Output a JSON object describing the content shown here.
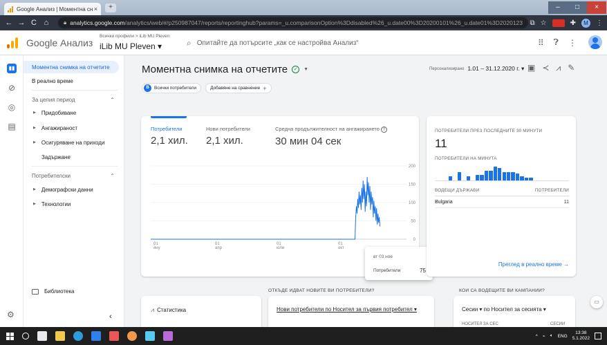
{
  "browser": {
    "tab_title": "Google Анализ | Моментна сн",
    "tab_close": "×",
    "new_tab": "+",
    "url_host": "analytics.google.com",
    "url_path": "/analytics/web/#/p250987047/reports/reportinghub?params=_u.comparisonOption%3Ddisabled%26_u.date00%3D20200101%26_u.date01%3D20201231",
    "back": "←",
    "forward": "→",
    "reload": "C",
    "home": "⌂",
    "extension_m": "M"
  },
  "header": {
    "product_name": "Google Анализ",
    "breadcrumb": "Всички профили > iLib MU Pleven",
    "property_name": "iLib MU Pleven ▾",
    "search_placeholder": "Опитайте да потърсите „как се настройва Анализ“"
  },
  "sidebar": {
    "items": [
      {
        "label": "Моментна снимка на отчетите"
      },
      {
        "label": "В реално време"
      },
      {
        "label": "За целия период"
      },
      {
        "label": "Придобиване"
      },
      {
        "label": "Ангажираност"
      },
      {
        "label": "Осигуряване на приходи"
      },
      {
        "label": "Задържане"
      },
      {
        "label": "Потребителски"
      },
      {
        "label": "Демографски данни"
      },
      {
        "label": "Технологии"
      }
    ],
    "library": "Библиотека",
    "collapse": "‹"
  },
  "main": {
    "title": "Моментна снимка на отчетите",
    "date_label": "Персонализирано",
    "date_range": "1.01 – 31.12.2020 г. ▾",
    "chip_all_users": "Всички потребители",
    "chip_all_users_badge": "B",
    "chip_compare": "Добавяне на сравнение",
    "metrics": [
      {
        "label": "Потребители",
        "value": "2,1 хил."
      },
      {
        "label": "Нови потребители",
        "value": "2,1 хил."
      },
      {
        "label": "Средна продължителност на ангажирането",
        "value": "30 мин 04 сек"
      }
    ],
    "tooltip": {
      "date": "вт 03 ное",
      "key": "Потребители",
      "value": "75"
    }
  },
  "realtime": {
    "title": "ПОТРЕБИТЕЛИ ПРЕЗ ПОСЛЕДНИТЕ 30 МИНУТИ",
    "count": "11",
    "per_minute": "ПОТРЕБИТЕЛИ НА МИНУТА",
    "col_country": "ВОДЕЩИ ДЪРЖАВИ",
    "col_users": "ПОТРЕБИТЕЛИ",
    "row_country": "Bulgaria",
    "row_users": "11",
    "link": "Преглед в реално време →",
    "bars": [
      0,
      0,
      0,
      0.3,
      0,
      0.6,
      0,
      0.3,
      0,
      0.4,
      0.4,
      0.7,
      0.7,
      1.0,
      0.9,
      0.6,
      0.6,
      0.6,
      0.5,
      0.3,
      0.2,
      0.2,
      0,
      0,
      0,
      0,
      0,
      0,
      0,
      0
    ]
  },
  "bottom": {
    "section_new_users": "ОТКЪДЕ ИДВАТ НОВИТЕ ВИ ПОТРЕБИТЕЛИ?",
    "section_campaigns": "КОИ СА ВОДЕЩИТЕ ВИ КАМПАНИИ?",
    "insights": "Статистика",
    "new_users_dim": "Нови потребители по Носител за първия потребител ▾",
    "sessions_dim": "Сесии ▾ по Носител за сесията ▾",
    "sessions_col1": "НОСИТЕЛ ЗА СЕС",
    "sessions_col2": "СЕСИИ"
  },
  "taskbar": {
    "lang": "ENG",
    "time": "13:38",
    "date": "5.1.2022"
  },
  "chart_data": {
    "type": "line",
    "x_tick_labels": [
      "01 яну",
      "01 апр",
      "01 юли",
      "01 окт"
    ],
    "y_ticks": [
      0,
      50,
      100,
      150,
      200
    ],
    "ylim": [
      0,
      200
    ],
    "x_range": [
      0,
      365
    ],
    "series": [
      {
        "points": [
          [
            0,
            0
          ],
          [
            303,
            0
          ],
          [
            304,
            60
          ],
          [
            305,
            90
          ],
          [
            306,
            70
          ],
          [
            307,
            110
          ],
          [
            308,
            85
          ],
          [
            309,
            130
          ],
          [
            310,
            95
          ],
          [
            311,
            120
          ],
          [
            312,
            80
          ],
          [
            313,
            140
          ],
          [
            314,
            100
          ],
          [
            315,
            160
          ],
          [
            316,
            110
          ],
          [
            317,
            150
          ],
          [
            318,
            75
          ],
          [
            319,
            130
          ],
          [
            320,
            90
          ],
          [
            321,
            170
          ],
          [
            322,
            120
          ],
          [
            323,
            155
          ],
          [
            324,
            100
          ],
          [
            325,
            145
          ],
          [
            326,
            80
          ],
          [
            327,
            130
          ],
          [
            328,
            95
          ],
          [
            329,
            115
          ],
          [
            330,
            60
          ],
          [
            331,
            105
          ],
          [
            332,
            70
          ],
          [
            333,
            90
          ],
          [
            334,
            50
          ],
          [
            335,
            85
          ],
          [
            336,
            40
          ],
          [
            337,
            70
          ],
          [
            338,
            45
          ],
          [
            339,
            60
          ],
          [
            340,
            35
          ]
        ]
      }
    ]
  },
  "colors": {
    "accent": "#1a73e8",
    "line": "#1a73e8",
    "logo_orange": "#f9ab00",
    "logo_dark": "#e37400"
  }
}
